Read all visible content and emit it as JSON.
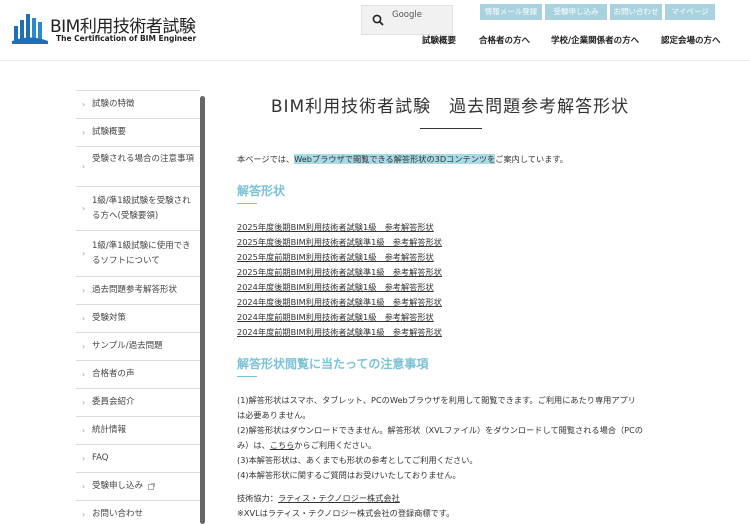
{
  "header": {
    "logo_title": "BIM利用技術者試験",
    "logo_sub": "The Certification of BIM Engineer",
    "search_label": "Google",
    "top_buttons": [
      "情報メール登録",
      "受験申し込み",
      "お問い合わせ",
      "マイページ"
    ],
    "nav": [
      "試験概要",
      "合格者の方へ",
      "学校/企業関係者の方へ",
      "認定会場の方へ"
    ]
  },
  "sidebar": {
    "items": [
      "試験の特徴",
      "試験概要",
      "受験される場合の注意事項",
      "1級/準1級試験を受験される方へ(受験要領)",
      "1級/準1級試験に使用できるソフトについて",
      "過去問題参考解答形状",
      "受験対策",
      "サンプル/過去問題",
      "合格者の声",
      "委員会紹介",
      "統計情報",
      "FAQ",
      "受験申し込み",
      "お問い合わせ"
    ]
  },
  "main": {
    "title": "BIM利用技術者試験　過去問題参考解答形状",
    "intro_pre": "本ページでは、",
    "intro_hl": "Webブラウザで閲覧できる解答形状の3Dコンテンツを",
    "intro_post": "ご案内しています。",
    "section1": "解答形状",
    "links": [
      "2025年度後期BIM利用技術者試験1級　参考解答形状",
      "2025年度後期BIM利用技術者試験準1級　参考解答形状",
      "2025年度前期BIM利用技術者試験1級　参考解答形状",
      "2025年度前期BIM利用技術者試験準1級　参考解答形状",
      "2024年度後期BIM利用技術者試験1級　参考解答形状",
      "2024年度後期BIM利用技術者試験準1級　参考解答形状",
      "2024年度前期BIM利用技術者試験1級　参考解答形状",
      "2024年度前期BIM利用技術者試験準1級　参考解答形状"
    ],
    "section2": "解答形状閲覧に当たっての注意事項",
    "notes": {
      "n1a": "(1)解答形状はスマホ、タブレット、PCのWebブラウザを利用して閲覧できます。ご利用にあたり専用アプリ",
      "n1b": "は必要ありません。",
      "n2a": "(2)解答形状はダウンロードできません。解答形状（XVLファイル）をダウンロードして閲覧される場合（PCの",
      "n2b_pre": "み）は、",
      "n2b_link": "こちら",
      "n2b_post": "からご利用ください。",
      "n3": "(3)本解答形状は、あくまでも形状の参考としてご利用ください。",
      "n4": "(4)本解答形状に関するご質問はお受けいたしておりません。"
    },
    "credit_pre": "技術協力：",
    "credit_link": "ラティス・テクノロジー株式会社",
    "trademark": "※XVLはラティス・テクノロジー株式会社の登録商標です。"
  },
  "colors": {
    "accent": "#7cc3d7",
    "button": "#a9d2df",
    "highlight": "#a8dbe8"
  }
}
